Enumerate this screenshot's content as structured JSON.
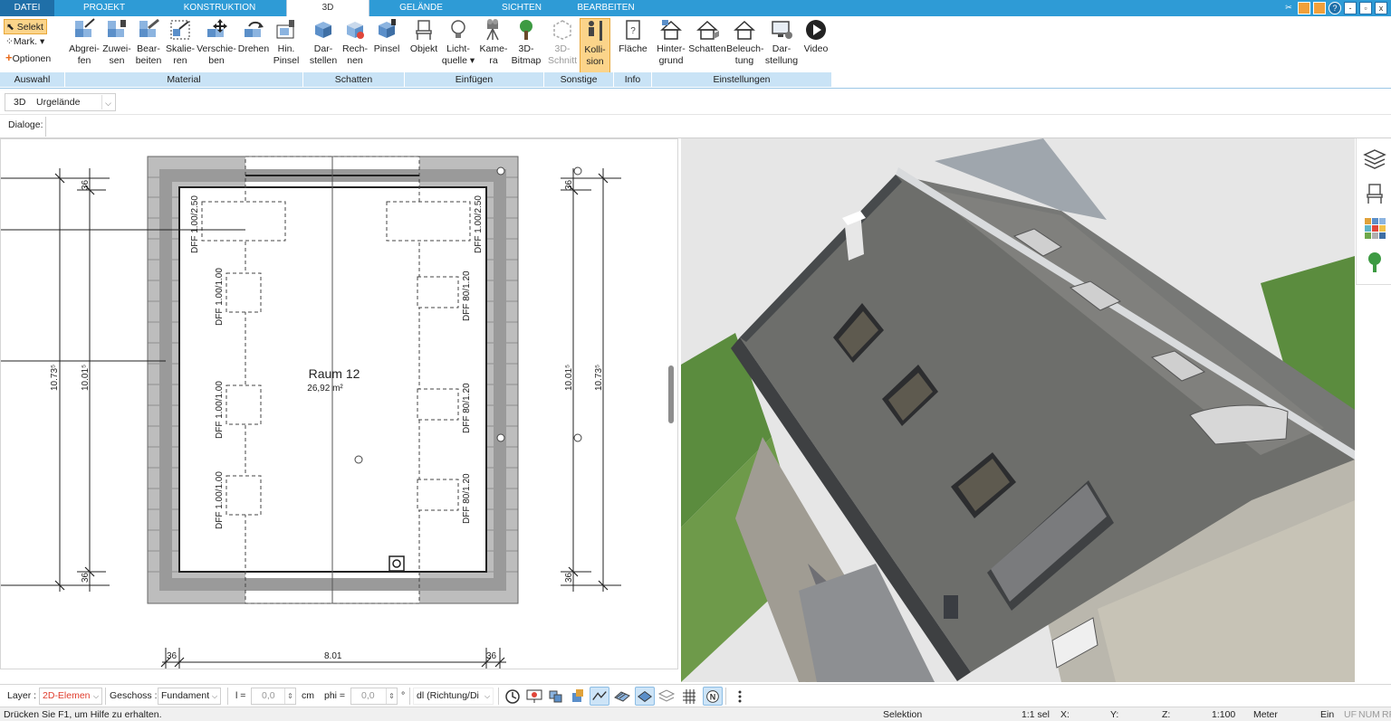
{
  "tabs": [
    {
      "label": "DATEI"
    },
    {
      "label": "PROJEKT"
    },
    {
      "label": "KONSTRUKTION"
    },
    {
      "label": "3D"
    },
    {
      "label": "GELÄNDE"
    },
    {
      "label": "SICHTEN"
    },
    {
      "label": "BEARBEITEN"
    }
  ],
  "window": {
    "help": "?",
    "minimize": "-",
    "restore": "▫",
    "close": "x"
  },
  "ribbon": {
    "auswahl": {
      "selekt": "Selekt",
      "mark": "Mark.",
      "optionen": "Optionen",
      "group": "Auswahl"
    },
    "material": {
      "group": "Material",
      "buttons": [
        {
          "l1": "Abgrei-",
          "l2": "fen"
        },
        {
          "l1": "Zuwei-",
          "l2": "sen"
        },
        {
          "l1": "Bear-",
          "l2": "beiten"
        },
        {
          "l1": "Skalie-",
          "l2": "ren"
        },
        {
          "l1": "Verschie-",
          "l2": "ben"
        },
        {
          "l1": "Drehen",
          "l2": ""
        },
        {
          "l1": "Hin.",
          "l2": "Pinsel"
        }
      ]
    },
    "schatten": {
      "group": "Schatten",
      "buttons": [
        {
          "l1": "Dar-",
          "l2": "stellen"
        },
        {
          "l1": "Rech-",
          "l2": "nen"
        },
        {
          "l1": "Pinsel",
          "l2": ""
        }
      ]
    },
    "einfuegen": {
      "group": "Einfügen",
      "buttons": [
        {
          "l1": "Objekt",
          "l2": ""
        },
        {
          "l1": "Licht-",
          "l2": "quelle ▾"
        },
        {
          "l1": "Kame-",
          "l2": "ra"
        },
        {
          "l1": "3D-",
          "l2": "Bitmap"
        }
      ]
    },
    "sonstige": {
      "group": "Sonstige",
      "buttons": [
        {
          "l1": "3D-",
          "l2": "Schnitt"
        },
        {
          "l1": "Kolli-",
          "l2": "sion"
        }
      ]
    },
    "info": {
      "group": "Info",
      "buttons": [
        {
          "l1": "Fläche",
          "l2": ""
        }
      ]
    },
    "einstellungen": {
      "group": "Einstellungen",
      "buttons": [
        {
          "l1": "Hinter-",
          "l2": "grund"
        },
        {
          "l1": "Schatten",
          "l2": ""
        },
        {
          "l1": "Beleuch-",
          "l2": "tung"
        },
        {
          "l1": "Dar-",
          "l2": "stellung"
        },
        {
          "l1": "Video",
          "l2": ""
        }
      ]
    }
  },
  "viewbar": {
    "mode": "3D",
    "terrain": "Urgelände",
    "dialoge": "Dialoge:"
  },
  "plan": {
    "room_name": "Raum 12",
    "room_area": "26,92 m²",
    "windows_left": [
      "DFF 1.00/2.50",
      "DFF 1.00/1.00",
      "DFF 1.00/1.00",
      "DFF 1.00/1.00"
    ],
    "windows_right": [
      "DFF 1.00/2.50",
      "DFF 80/1.20",
      "DFF 80/1.20",
      "DFF 80/1.20"
    ],
    "dims_left_outer": "10.73⁵",
    "dims_left_inner": "10.01⁵",
    "dims_right_inner": "10.01⁵",
    "dims_right_outer": "10.73⁵",
    "dim_36": "36",
    "dim_bottom": "8.01"
  },
  "bottombar": {
    "layer_label": "Layer :",
    "layer_value": "2D-Elemen",
    "geschoss_label": "Geschoss :",
    "geschoss_value": "Fundament",
    "l_label": "l =",
    "l_value": "0,0",
    "l_unit": "cm",
    "phi_label": "phi =",
    "phi_value": "0,0",
    "phi_unit": "°",
    "dl_value": "dl (Richtung/Di",
    "colors": {
      "layer": "#e03c2c"
    }
  },
  "status": {
    "help": "Drücken Sie F1, um Hilfe zu erhalten.",
    "mode": "Selektion",
    "sel": "1:1 sel",
    "x": "X:",
    "y": "Y:",
    "z": "Z:",
    "scale": "1:100",
    "unit": "Meter",
    "ein": "Ein",
    "uf": "UF",
    "num": "NUM",
    "rf": "RF"
  }
}
